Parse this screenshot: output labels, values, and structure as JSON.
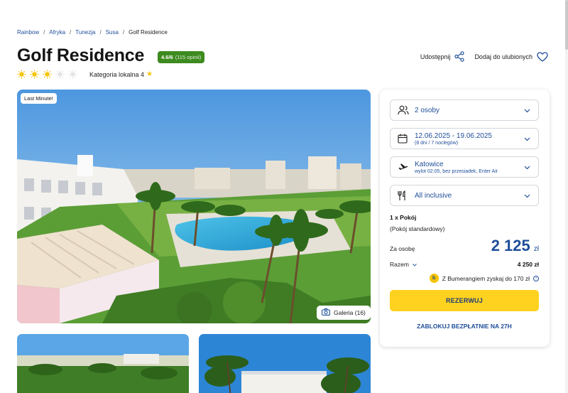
{
  "breadcrumb": {
    "items": [
      "Rainbow",
      "Afryka",
      "Tunezja",
      "Susa"
    ],
    "current": "Golf Residence",
    "separator": "/"
  },
  "hotel": {
    "name": "Golf Residence",
    "rating_score": "4.6/6",
    "rating_count": "(115 opinii)",
    "suns_filled": 3,
    "suns_total": 5,
    "local_category": "Kategoria lokalna 4"
  },
  "actions": {
    "share": "Udostępnij",
    "favorite": "Dodaj do ulubionych"
  },
  "gallery": {
    "badge": "Last Minute!",
    "button": "Galeria (16)"
  },
  "booking": {
    "guests": "2 osoby",
    "dates": "12.06.2025 - 19.06.2025",
    "dates_sub": "(8 dni / 7 noclegów)",
    "departure": "Katowice",
    "departure_sub": "wylot 02:05, bez przesiadek, Enter Air",
    "board": "All inclusive",
    "room_title": "1 x Pokój",
    "room_sub": "(Pokój standardowy)",
    "per_person_label": "Za osobę",
    "price": "2 125",
    "currency": "zł",
    "total_label": "Razem",
    "total_value": "4 250 zł",
    "bumerang": "Z Bumerangiem zyskaj do 170 zł",
    "book_button": "REZERWUJ",
    "block_button": "ZABLOKUJ BEZPŁATNIE NA 27H"
  },
  "colors": {
    "brand_blue": "#1f4e9a",
    "accent_yellow": "#ffd21f",
    "rating_green": "#3d8b1f"
  }
}
